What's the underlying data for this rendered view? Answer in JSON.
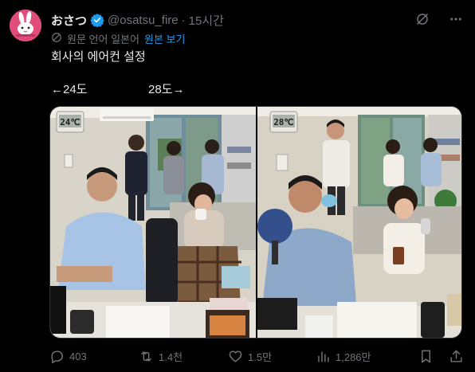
{
  "post": {
    "display_name": "おさつ",
    "handle": "@osatsu_fire",
    "separator": "·",
    "time": "15시간",
    "translation_note": "원문 언어 일본어",
    "translation_link": "원본 보기",
    "text": "회사의 에어컨 설정",
    "label_left": "←24도",
    "label_right": "28도→"
  },
  "media": {
    "left_thermostat": "24℃",
    "right_thermostat": "28℃"
  },
  "actions": {
    "replies": "403",
    "reposts": "1.4천",
    "likes": "1.5만",
    "views": "1,286만"
  },
  "colors": {
    "background": "#000000",
    "text": "#e7e9ea",
    "muted": "#71767b",
    "accent": "#1d9bf0",
    "avatar": "#e24c7a"
  },
  "icons": {
    "verified": "verified-badge-icon",
    "grok": "grok-icon",
    "more": "more-icon",
    "translate": "translate-icon",
    "reply": "reply-icon",
    "repost": "repost-icon",
    "like": "heart-icon",
    "views": "views-icon",
    "bookmark": "bookmark-icon",
    "share": "share-icon"
  }
}
